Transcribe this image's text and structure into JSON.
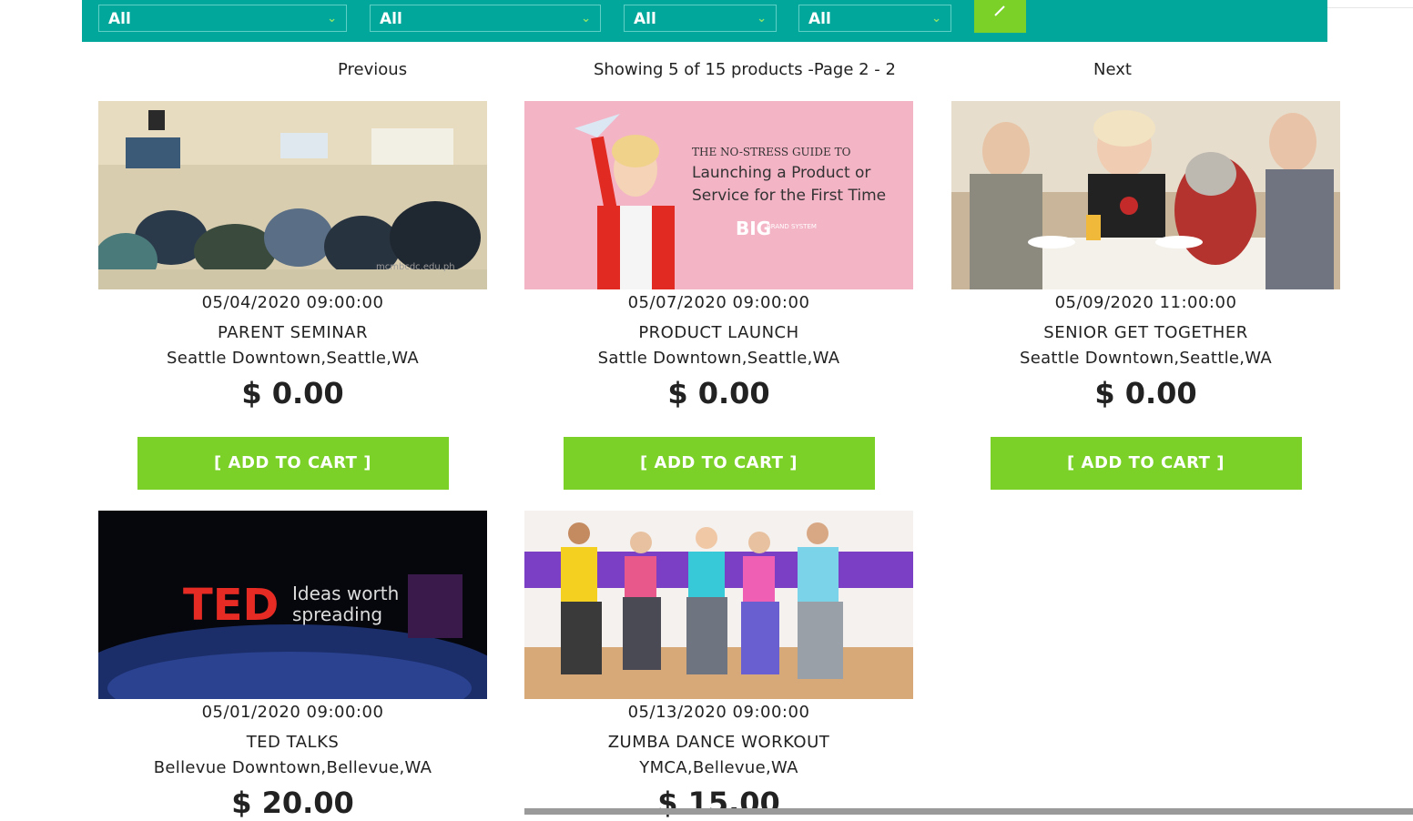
{
  "filters": [
    {
      "value": "All"
    },
    {
      "value": "All"
    },
    {
      "value": "All"
    },
    {
      "value": "All"
    }
  ],
  "pagination": {
    "previous": "Previous",
    "status": "Showing 5 of 15 products -Page 2 - 2",
    "next": "Next"
  },
  "products": [
    {
      "date": "05/04/2020 09:00:00",
      "name": "PARENT SEMINAR",
      "location": "Seattle Downtown,Seattle,WA",
      "price": "$ 0.00",
      "cart_label": "[ ADD TO CART ]",
      "image_caption": "mcmbcdc.edu.ph"
    },
    {
      "date": "05/07/2020 09:00:00",
      "name": "PRODUCT LAUNCH",
      "location": "Sattle Downtown,Seattle,WA",
      "price": "$ 0.00",
      "cart_label": "[ ADD TO CART ]",
      "image_lines": [
        "THE NO-STRESS GUIDE TO",
        "Launching a Product or",
        "Service for the First Time",
        "BIG",
        "BRAND SYSTEM"
      ]
    },
    {
      "date": "05/09/2020 11:00:00",
      "name": "SENIOR GET TOGETHER",
      "location": "Seattle Downtown,Seattle,WA",
      "price": "$ 0.00",
      "cart_label": "[ ADD TO CART ]"
    },
    {
      "date": "05/01/2020 09:00:00",
      "name": "TED TALKS",
      "location": "Bellevue Downtown,Bellevue,WA",
      "price": "$ 20.00",
      "image_lines": [
        "TED",
        "Ideas worth",
        "spreading"
      ]
    },
    {
      "date": "05/13/2020 09:00:00",
      "name": "ZUMBA DANCE WORKOUT",
      "location": "YMCA,Bellevue,WA",
      "price": "$ 15.00"
    }
  ],
  "colors": {
    "filter_bar": "#00a79a",
    "accent_green": "#7bd128"
  }
}
